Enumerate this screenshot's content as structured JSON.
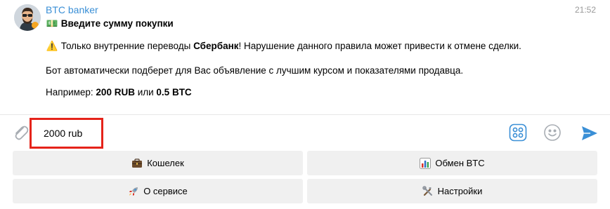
{
  "message": {
    "sender": "BTC banker",
    "time": "21:52",
    "title_emoji": "💵",
    "title": "Введите сумму покупки",
    "warning_emoji": "⚠️",
    "warning_pre": "Только внутренние переводы ",
    "warning_bold": "Сбербанк",
    "warning_post": "! Нарушение данного правила может привести к отмене сделки.",
    "auto_text": "Бот автоматически подберет для Вас объявление с лучшим курсом и показателями продавца.",
    "example_pre": "Например: ",
    "example_bold1": "200 RUB",
    "example_mid": " или ",
    "example_bold2": "0.5 BTC"
  },
  "composer": {
    "input_value": "2000 rub",
    "attach_icon": "paperclip-icon",
    "commands_icon": "bot-commands-icon",
    "emoji_icon": "smile-icon",
    "send_icon": "send-icon"
  },
  "keyboard": {
    "wallet": "Кошелек",
    "exchange": "Обмен BTC",
    "about": "О сервисе",
    "settings": "Настройки"
  },
  "colors": {
    "accent": "#3a8fd6",
    "highlight": "#e5231a",
    "button_bg": "#f0f0f0"
  }
}
